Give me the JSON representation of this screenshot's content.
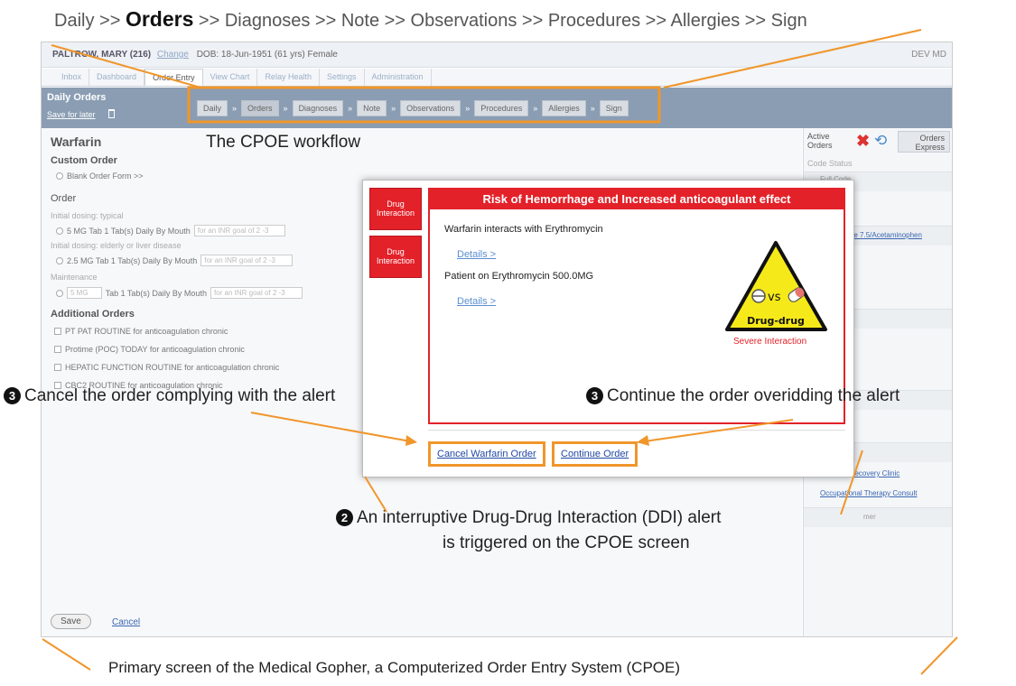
{
  "top_caption": {
    "daily": "Daily >> ",
    "orders": "Orders",
    "rest": " >> Diagnoses >> Note >> Observations >> Procedures >> Allergies >> Sign"
  },
  "patient_bar": {
    "name": "PALTROW, MARY (216)",
    "change": "Change",
    "dob": "DOB: 18-Jun-1951 (61 yrs) Female",
    "env": "DEV MD"
  },
  "tabs": [
    "Inbox",
    "Dashboard",
    "Order Entry",
    "View Chart",
    "Relay Health",
    "Settings",
    "Administration"
  ],
  "workflow_bar": {
    "title": "Daily Orders",
    "save_later": "Save for later",
    "steps": [
      "Daily",
      "Orders",
      "Diagnoses",
      "Note",
      "Observations",
      "Procedures",
      "Allergies",
      "Sign"
    ],
    "sep": "»"
  },
  "main": {
    "drug": "Warfarin",
    "custom_order": "Custom Order",
    "blank_form": "Blank Order Form >>",
    "order": "Order",
    "initial_typical": "Initial dosing: typical",
    "opt1": "5 MG Tab 1 Tab(s) Daily By Mouth",
    "initial_elderly": "Initial dosing: elderly or liver disease",
    "opt2": "2.5 MG Tab 1 Tab(s) Daily By Mouth",
    "maintenance": "Maintenance",
    "opt3_sel": "5 MG",
    "opt3": "Tab 1 Tab(s) Daily By Mouth",
    "goal": "for an INR goal of 2 -3",
    "additional": "Additional Orders",
    "add_orders": [
      "PT PAT ROUTINE for anticoagulation chronic",
      "Protime (POC) TODAY for anticoagulation chronic",
      "HEPATIC FUNCTION ROUTINE for anticoagulation chronic",
      "CBC2 ROUTINE for anticoagulation chronic"
    ],
    "save": "Save",
    "cancel": "Cancel"
  },
  "right": {
    "active_orders_1": "Active",
    "active_orders_2": "Orders",
    "express_1": "Orders",
    "express_2": "Express",
    "code_status": "Code Status",
    "full_code": "Full Code",
    "item_hydrocodone": "done 7.5/Acetaminophen",
    "item_rehab": "e Recovery Clinic",
    "item_ot": "Occupational Therapy Consult",
    "item_mer": "mer"
  },
  "modal": {
    "tab1": "Drug Interaction",
    "tab2": "Drug Interaction",
    "title": "Risk of Hemorrhage and Increased anticoagulant effect",
    "line1": "Warfarin interacts with Erythromycin",
    "details1": "Details >",
    "line2": "Patient on Erythromycin 500.0MG",
    "details2": "Details >",
    "hazard_vs": "vs",
    "hazard_label": "Drug-drug",
    "severe": "Severe Interaction",
    "cancel_btn": "Cancel Warfarin Order",
    "continue_btn": "Continue Order"
  },
  "annotations": {
    "cpoe_workflow": "The CPOE workflow",
    "num3": "3",
    "num2": "2",
    "cancel_note": "Cancel the order complying with the alert",
    "continue_note": "Continue the order overidding the alert",
    "ddi_line1": "An interruptive Drug-Drug Interaction (DDI) alert",
    "ddi_line2": "is triggered on the CPOE screen",
    "bottom": "Primary screen of the Medical Gopher, a Computerized Order Entry System (CPOE)"
  },
  "colors": {
    "alert_red": "#e32129",
    "highlight_orange": "#f0962b",
    "header_blue": "#8a9db3"
  }
}
